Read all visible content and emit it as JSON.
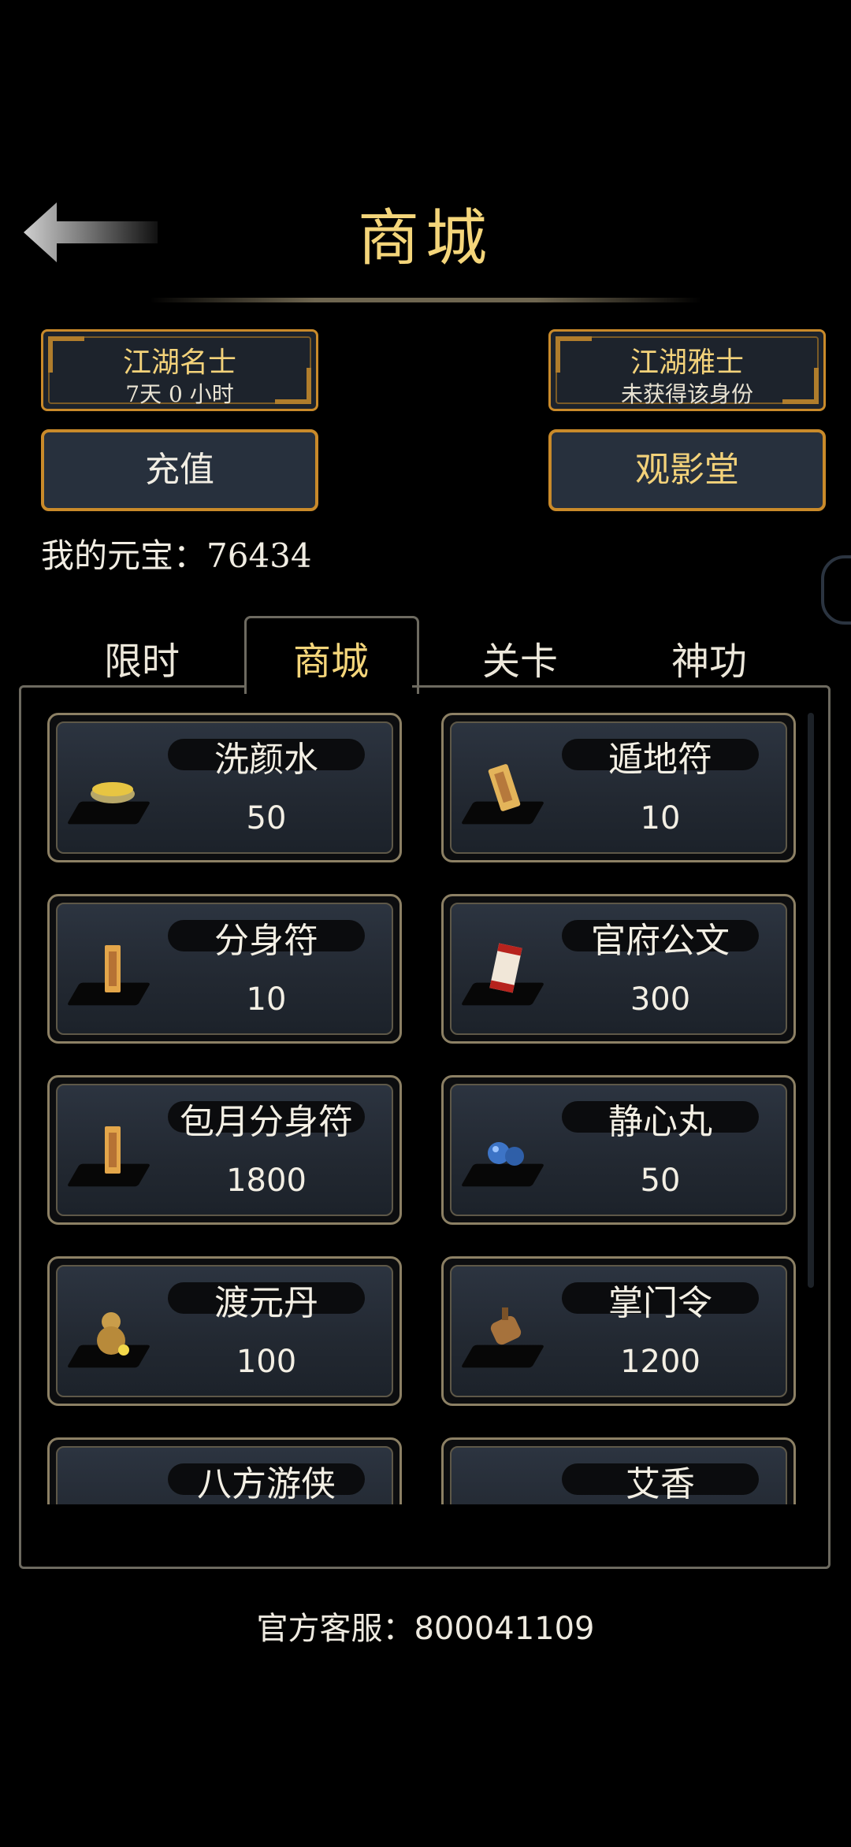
{
  "header": {
    "title": "商城",
    "back_icon": "back-arrow-icon"
  },
  "ranks": [
    {
      "title": "江湖名士",
      "subtitle": "7天 0 小时"
    },
    {
      "title": "江湖雅士",
      "subtitle": "未获得该身份"
    }
  ],
  "buttons": {
    "recharge": "充值",
    "theater": "观影堂"
  },
  "currency": {
    "label": "我的元宝：76434"
  },
  "tabs": [
    "限时",
    "商城",
    "关卡",
    "神功"
  ],
  "items": [
    {
      "name": "洗颜水",
      "price": "50",
      "icon": "bowl-icon"
    },
    {
      "name": "遁地符",
      "price": "10",
      "icon": "talisman-icon"
    },
    {
      "name": "分身符",
      "price": "10",
      "icon": "talisman-icon"
    },
    {
      "name": "官府公文",
      "price": "300",
      "icon": "scroll-icon"
    },
    {
      "name": "包月分身符",
      "price": "1800",
      "icon": "talisman-icon"
    },
    {
      "name": "静心丸",
      "price": "50",
      "icon": "pill-icon"
    },
    {
      "name": "渡元丹",
      "price": "100",
      "icon": "gourd-icon"
    },
    {
      "name": "掌门令",
      "price": "1200",
      "icon": "token-icon"
    },
    {
      "name": "八方游侠",
      "price": "",
      "icon": "mask-icon"
    },
    {
      "name": "艾香",
      "price": "",
      "icon": "incense-icon"
    }
  ],
  "footer": {
    "service": "官方客服：800041109"
  },
  "colors": {
    "gold": "#f4d57a",
    "border": "#c98a2a",
    "panel": "#27303d"
  }
}
